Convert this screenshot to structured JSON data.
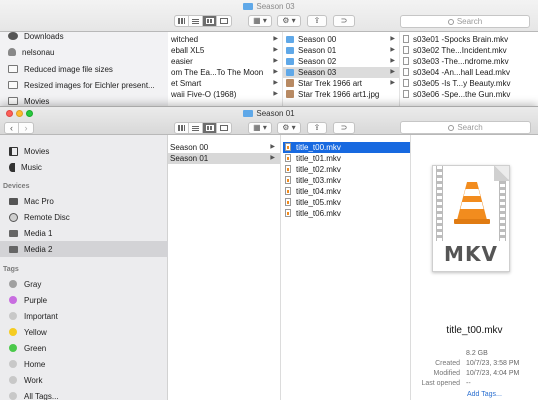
{
  "back_window": {
    "title": "Season 03",
    "search_placeholder": "Search",
    "sidebar": [
      {
        "label": "Downloads",
        "icon": "downloads-icon"
      },
      {
        "label": "nelsonau",
        "icon": "home-icon"
      },
      {
        "label": "Reduced image file sizes",
        "icon": "folder-icon"
      },
      {
        "label": "Resized images for Eichler present...",
        "icon": "folder-icon"
      },
      {
        "label": "Movies",
        "icon": "movies-icon"
      }
    ],
    "column1": [
      {
        "label": "witched"
      },
      {
        "label": "eball XL5"
      },
      {
        "label": "easier"
      },
      {
        "label": "om The Ea...To The Moon"
      },
      {
        "label": "et Smart"
      },
      {
        "label": "waii Five-O (1968)"
      }
    ],
    "column2": [
      {
        "label": "Season 00",
        "kind": "folder"
      },
      {
        "label": "Season 01",
        "kind": "folder"
      },
      {
        "label": "Season 02",
        "kind": "folder"
      },
      {
        "label": "Season 03",
        "kind": "folder",
        "selected": true
      },
      {
        "label": "Star Trek 1966 art",
        "kind": "image"
      },
      {
        "label": "Star Trek 1966 art1.jpg",
        "kind": "image"
      }
    ],
    "column3": [
      "s03e01 -Spocks Brain.mkv",
      "s03e02 The...Incident.mkv",
      "s03e03 -The...ndrome.mkv",
      "s03e04 -An...hall Lead.mkv",
      "s03e05 -Is T...y Beauty.mkv",
      "s03e06 -Spe...the Gun.mkv"
    ]
  },
  "front_window": {
    "title": "Season 01",
    "search_placeholder": "Search",
    "sidebar_top": [
      {
        "label": "Movies",
        "icon": "movies-icon"
      },
      {
        "label": "Music",
        "icon": "music-icon"
      }
    ],
    "devices_heading": "Devices",
    "devices": [
      {
        "label": "Mac Pro",
        "icon": "computer-icon"
      },
      {
        "label": "Remote Disc",
        "icon": "disc-icon"
      },
      {
        "label": "Media 1",
        "icon": "drive-icon"
      },
      {
        "label": "Media 2",
        "icon": "drive-icon",
        "selected": true
      }
    ],
    "tags_heading": "Tags",
    "tags": [
      {
        "label": "Gray",
        "color": "#a0a0a0"
      },
      {
        "label": "Purple",
        "color": "#c86de0"
      },
      {
        "label": "Important",
        "color": "#c8c8c8"
      },
      {
        "label": "Yellow",
        "color": "#f5cc22"
      },
      {
        "label": "Green",
        "color": "#4bc94b"
      },
      {
        "label": "Home",
        "color": "#c8c8c8"
      },
      {
        "label": "Work",
        "color": "#c8c8c8"
      },
      {
        "label": "All Tags...",
        "color": "#c8c8c8"
      }
    ],
    "seasons": [
      {
        "label": "Season 00"
      },
      {
        "label": "Season 01",
        "selected": true
      }
    ],
    "files": [
      "title_t00.mkv",
      "title_t01.mkv",
      "title_t02.mkv",
      "title_t03.mkv",
      "title_t04.mkv",
      "title_t05.mkv",
      "title_t06.mkv"
    ],
    "preview": {
      "file_type_badge": "MKV",
      "file_name": "title_t00.mkv",
      "size": "8.2 GB",
      "created_label": "Created",
      "created": "10/7/23, 3:58 PM",
      "modified_label": "Modified",
      "modified": "10/7/23, 4:04 PM",
      "last_opened_label": "Last opened",
      "last_opened": "--",
      "add_tags": "Add Tags..."
    }
  }
}
